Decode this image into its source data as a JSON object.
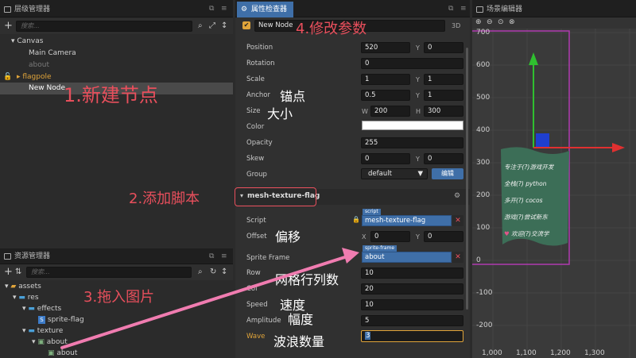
{
  "hierarchy": {
    "tab": "层级管理器",
    "search_placeholder": "搜索...",
    "items": [
      "Canvas",
      "Main Camera",
      "about",
      "flagpole",
      "New Node"
    ]
  },
  "assets": {
    "tab": "资源管理器",
    "search_placeholder": "搜索...",
    "items": [
      "assets",
      "res",
      "effects",
      "sprite-flag",
      "texture",
      "about",
      "about"
    ]
  },
  "inspector": {
    "tab": "属性检查器",
    "node_name": "New Node",
    "mode": "3D",
    "position": {
      "label": "Position",
      "x": "520",
      "y": "0"
    },
    "rotation": {
      "label": "Rotation",
      "value": "0"
    },
    "scale": {
      "label": "Scale",
      "x": "1",
      "y": "1"
    },
    "anchor": {
      "label": "Anchor",
      "x": "0.5",
      "y": "1"
    },
    "size": {
      "label": "Size",
      "w": "200",
      "h": "300"
    },
    "color": {
      "label": "Color"
    },
    "opacity": {
      "label": "Opacity",
      "value": "255"
    },
    "skew": {
      "label": "Skew",
      "x": "0",
      "y": "0"
    },
    "group": {
      "label": "Group",
      "value": "default",
      "edit": "编辑"
    },
    "component": "mesh-texture-flag",
    "script": {
      "label": "Script",
      "tag": "script",
      "value": "mesh-texture-flag"
    },
    "offset": {
      "label": "Offset",
      "x": "0",
      "y": "0"
    },
    "sprite_frame": {
      "label": "Sprite Frame",
      "tag": "sprite-frame",
      "value": "about"
    },
    "row": {
      "label": "Row",
      "value": "10"
    },
    "col": {
      "label": "Col",
      "value": "20"
    },
    "speed": {
      "label": "Speed",
      "value": "10"
    },
    "amplitude": {
      "label": "Amplitude",
      "value": "5"
    },
    "wave": {
      "label": "Wave",
      "value": "3"
    },
    "axis_x": "X",
    "axis_y": "Y",
    "axis_w": "W",
    "axis_h": "H"
  },
  "scene": {
    "tab": "场景编辑器",
    "y_ticks": [
      "700",
      "600",
      "500",
      "400",
      "300",
      "200",
      "100",
      "0",
      "-100",
      "-200"
    ],
    "x_ticks": [
      "1,000",
      "1,100",
      "1,200",
      "1,300"
    ],
    "flag_text": [
      "专注于(?)游戏开发",
      "全栈(?) python",
      "多开(?) cocos",
      "游戏(?)尝试新东",
      "欢迎(?)交流学"
    ]
  },
  "annotations": {
    "a1": "1.新建节点",
    "a2": "2.添加脚本",
    "a3": "3.拖入图片",
    "a4": "4.修改参数",
    "anchor": "锚点",
    "size": "大小",
    "offset": "偏移",
    "grid": "网格行列数",
    "speed": "速度",
    "amplitude": "幅度",
    "wave": "波浪数量"
  },
  "colors": {
    "accent": "#3f6fa8",
    "annotation": "#e84f5c",
    "gizmo_x": "#e03030",
    "gizmo_y": "#2fbf2f",
    "flag": "#3c6e57"
  }
}
